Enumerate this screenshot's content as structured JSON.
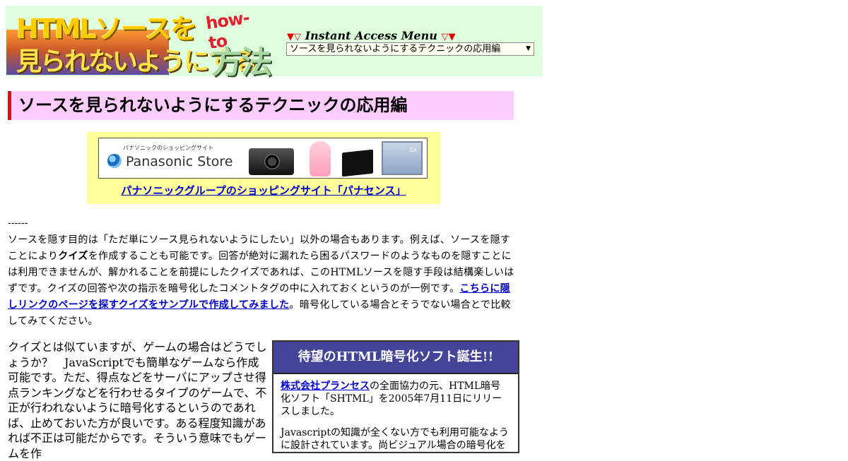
{
  "header": {
    "logo_line1": "HTMLソースを",
    "logo_line2": "見られないようにする",
    "logo_howto": "how-to",
    "logo_line3": "方法",
    "menu_title_prefix": "▼▽",
    "menu_title": "Instant Access Menu",
    "menu_title_suffix": "▽▼",
    "menu_selected": "ソースを見られないようにするテクニックの応用編"
  },
  "page_title": "ソースを見られないようにするテクニックの応用編",
  "ad": {
    "banner_small": "パナソニックのショッピングサイト",
    "banner_brand": "Panasonic Store",
    "link_text": "パナソニックグループのショッピングサイト「パナセンス」"
  },
  "content": {
    "dashes": "------",
    "p1_a": "ソースを隠す目的は「ただ単にソース見られないようにしたい」以外の場合もあります。例えば、ソースを隠すことにより",
    "p1_bold": "クイズ",
    "p1_b": "を作成することも可能です。回答が絶対に漏れたら困るパスワードのようなものを隠すことには利用できませんが、解かれることを前提にしたクイズであれば、このHTMLソースを隠す手段は結構楽しいはずです。クイズの回答や次の指示を暗号化したコメントタグの中に入れておくというのが一例です。",
    "p1_link": "こちらに隠しリンクのページを探すクイズをサンプルで作成してみました",
    "p1_c": "。暗号化している場合とそうでない場合とで比較してみてください。",
    "p2": "クイズとは似ていますが、ゲームの場合はどうでしょうか？　JavaScriptでも簡単なゲームなら作成可能です。ただ、得点などをサーバにアップさせ得点ランキングなどを行わせるタイプのゲームで、不正が行われないように暗号化するというのであれば、止めておいた方が良いです。ある程度知識があれば不正は可能だからです。そういう意味でもゲームを作"
  },
  "promo": {
    "title": "待望のHTML暗号化ソフト誕生!!",
    "company_link": "株式会社プランセス",
    "text1": "の全面協力の元、HTML暗号化ソフト「SHTML」を2005年7月11日にリリースしました。",
    "text2": "Javascriptの知識が全くない方でも利用可能なように設計されています。尚ビジュアル場合の暗号化を"
  },
  "colors": {
    "header_bg": "#ddffdd",
    "title_bg": "#ffccff",
    "title_border": "#dd1111",
    "ad_bg": "#ffff99",
    "link": "#0000cc",
    "promo_head": "#444499"
  }
}
